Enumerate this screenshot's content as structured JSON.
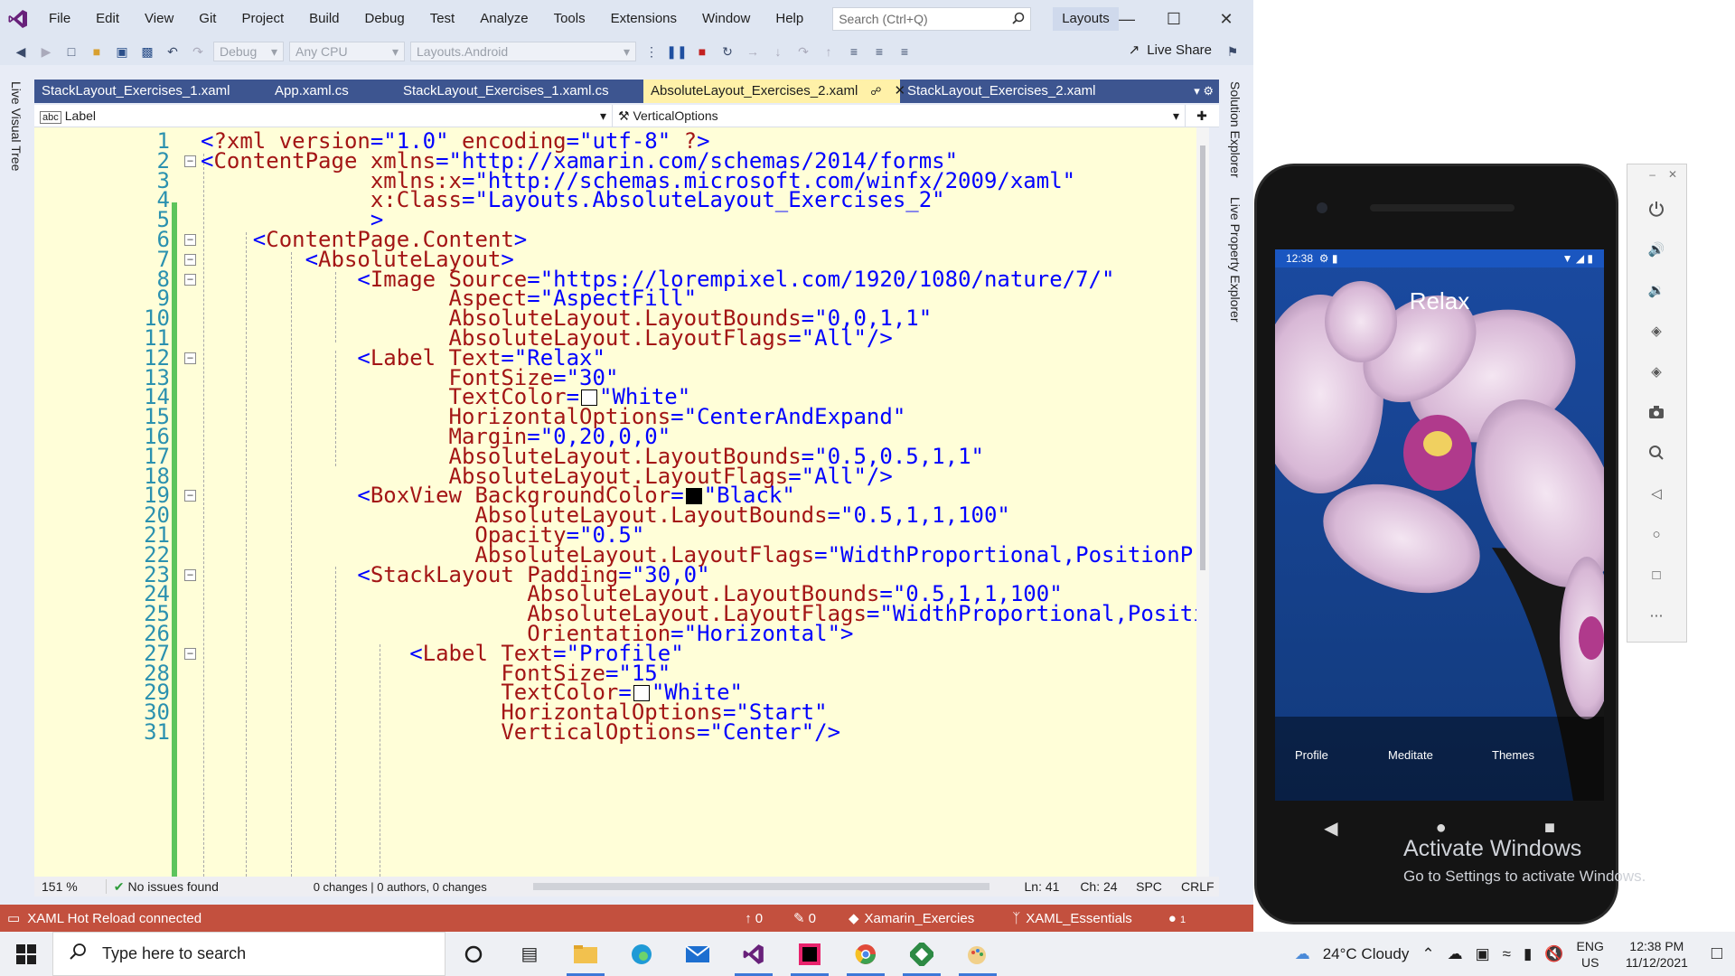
{
  "menubar": {
    "items": [
      "File",
      "Edit",
      "View",
      "Git",
      "Project",
      "Build",
      "Debug",
      "Test",
      "Analyze",
      "Tools",
      "Extensions",
      "Window",
      "Help"
    ],
    "search_placeholder": "Search (Ctrl+Q)",
    "solution_name": "Layouts"
  },
  "toolbar": {
    "config": "Debug",
    "platform": "Any CPU",
    "startup_project": "Layouts.Android",
    "live_share": "Live Share"
  },
  "left_rail": {
    "label": "Live Visual Tree"
  },
  "right_rail": {
    "solution_explorer": "Solution Explorer",
    "live_property_explorer": "Live Property Explorer"
  },
  "tabs": [
    {
      "label": "StackLayout_Exercises_1.xaml",
      "active": false
    },
    {
      "label": "App.xaml.cs",
      "active": false
    },
    {
      "label": "StackLayout_Exercises_1.xaml.cs",
      "active": false
    },
    {
      "label": "AbsoluteLayout_Exercises_2.xaml",
      "active": true
    },
    {
      "label": "StackLayout_Exercises_2.xaml",
      "active": false
    }
  ],
  "navbar": {
    "element": "Label",
    "member": "VerticalOptions"
  },
  "code_lines": [
    {
      "n": "1",
      "text": "<?xml version=\"1.0\" encoding=\"utf-8\" ?>"
    },
    {
      "n": "2",
      "text": "<ContentPage xmlns=\"http://xamarin.com/schemas/2014/forms\""
    },
    {
      "n": "3",
      "text": "             xmlns:x=\"http://schemas.microsoft.com/winfx/2009/xaml\""
    },
    {
      "n": "4",
      "text": "             x:Class=\"Layouts.AbsoluteLayout_Exercises_2\""
    },
    {
      "n": "5",
      "text": "             >"
    },
    {
      "n": "6",
      "text": "    <ContentPage.Content>"
    },
    {
      "n": "7",
      "text": "        <AbsoluteLayout>"
    },
    {
      "n": "8",
      "text": "            <Image Source=\"https://lorempixel.com/1920/1080/nature/7/\""
    },
    {
      "n": "9",
      "text": "                   Aspect=\"AspectFill\""
    },
    {
      "n": "10",
      "text": "                   AbsoluteLayout.LayoutBounds=\"0,0,1,1\""
    },
    {
      "n": "11",
      "text": "                   AbsoluteLayout.LayoutFlags=\"All\"/>"
    },
    {
      "n": "12",
      "text": "            <Label Text=\"Relax\""
    },
    {
      "n": "13",
      "text": "                   FontSize=\"30\""
    },
    {
      "n": "14",
      "text": "                   TextColor=□\"White\""
    },
    {
      "n": "15",
      "text": "                   HorizontalOptions=\"CenterAndExpand\""
    },
    {
      "n": "16",
      "text": "                   Margin=\"0,20,0,0\""
    },
    {
      "n": "17",
      "text": "                   AbsoluteLayout.LayoutBounds=\"0.5,0.5,1,1\""
    },
    {
      "n": "18",
      "text": "                   AbsoluteLayout.LayoutFlags=\"All\"/>"
    },
    {
      "n": "19",
      "text": "            <BoxView BackgroundColor=■\"Black\""
    },
    {
      "n": "20",
      "text": "                     AbsoluteLayout.LayoutBounds=\"0.5,1,1,100\""
    },
    {
      "n": "21",
      "text": "                     Opacity=\"0.5\""
    },
    {
      "n": "22",
      "text": "                     AbsoluteLayout.LayoutFlags=\"WidthProportional,PositionProportional\"/>"
    },
    {
      "n": "23",
      "text": "            <StackLayout Padding=\"30,0\""
    },
    {
      "n": "24",
      "text": "                         AbsoluteLayout.LayoutBounds=\"0.5,1,1,100\""
    },
    {
      "n": "25",
      "text": "                         AbsoluteLayout.LayoutFlags=\"WidthProportional,PositionProportional\""
    },
    {
      "n": "26",
      "text": "                         Orientation=\"Horizontal\">"
    },
    {
      "n": "27",
      "text": "                <Label Text=\"Profile\""
    },
    {
      "n": "28",
      "text": "                       FontSize=\"15\""
    },
    {
      "n": "29",
      "text": "                       TextColor=□\"White\""
    },
    {
      "n": "30",
      "text": "                       HorizontalOptions=\"Start\""
    },
    {
      "n": "31",
      "text": "                       VerticalOptions=\"Center\"/>"
    }
  ],
  "editor_status": {
    "zoom": "151 %",
    "issues": "No issues found",
    "changes": "0 changes | 0 authors, 0 changes",
    "ln": "Ln: 41",
    "ch": "Ch: 24",
    "spc": "SPC",
    "crlf": "CRLF"
  },
  "statusbar": {
    "hot_reload": "XAML Hot Reload connected",
    "up_count": "0",
    "edit_count": "0",
    "repo": "Xamarin_Exercies",
    "branch": "XAML_Essentials",
    "notifications": "1"
  },
  "phone": {
    "time": "12:38",
    "title": "Relax",
    "menu": [
      "Profile",
      "Meditate",
      "Themes"
    ]
  },
  "watermark": {
    "line1": "Activate Windows",
    "line2": "Go to Settings to activate Windows."
  },
  "taskbar": {
    "search_placeholder": "Type here to search",
    "weather": "24°C  Cloudy",
    "lang": "ENG",
    "region": "US",
    "time": "12:38 PM",
    "date": "11/12/2021"
  },
  "colors": {
    "vs_accent": "#68217a",
    "tab_strip": "#3d5590",
    "editor_bg": "#fffed8",
    "status_bar": "#c3503e",
    "xml_tag": "#a31515",
    "xml_attr": "#ff0000",
    "xml_value": "#0000ff",
    "line_number": "#2b91af"
  }
}
